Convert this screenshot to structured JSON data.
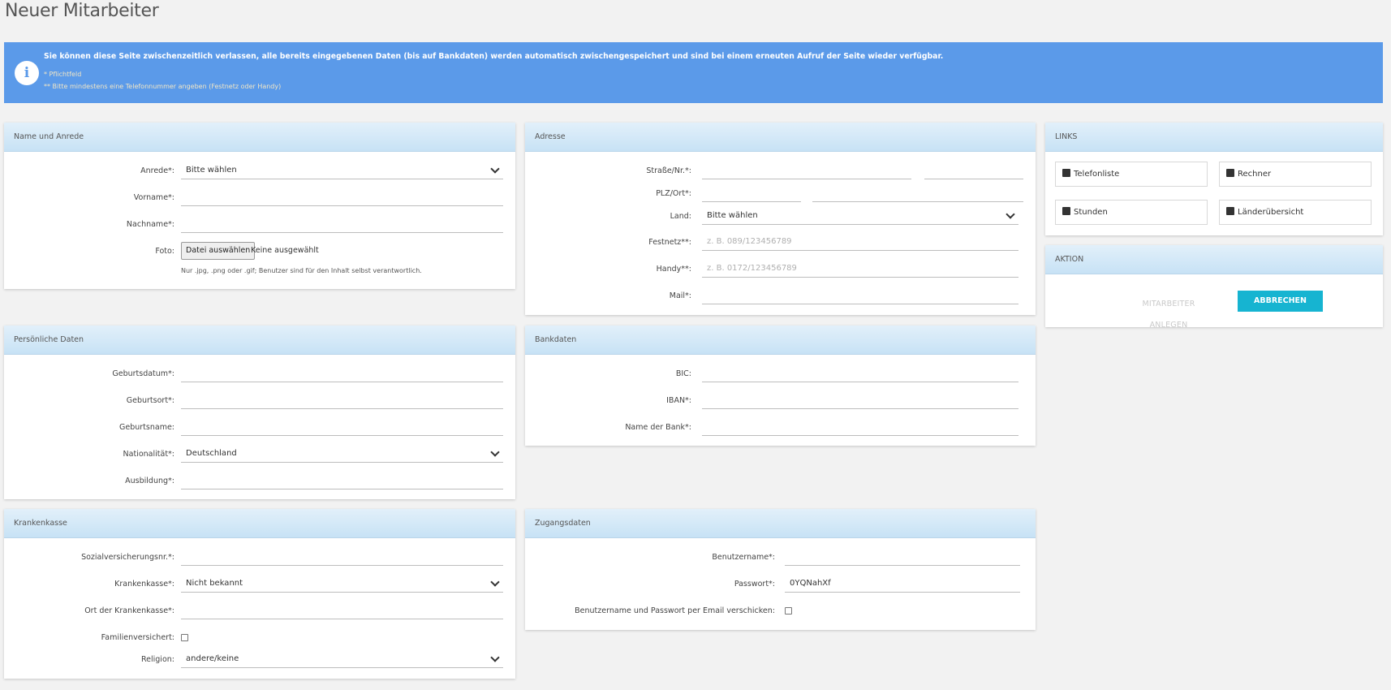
{
  "page": {
    "title": "Neuer Mitarbeiter"
  },
  "info": {
    "message": "Sie können diese Seite zwischenzeitlich verlassen, alle bereits eingegebenen Daten (bis auf Bankdaten) werden automatisch zwischengespeichert und sind bei einem erneuten Aufruf der Seite wieder verfügbar.",
    "note_required": "*  Pflichtfeld",
    "note_phone": "**  Bitte mindestens eine Telefonnummer angeben (Festnetz oder Handy)",
    "icon": "info-icon"
  },
  "name": {
    "title": "Name und Anrede",
    "anrede_label": "Anrede*:",
    "anrede_value": "Bitte wählen",
    "vorname_label": "Vorname*:",
    "nachname_label": "Nachname*:",
    "foto_label": "Foto:",
    "file_button": "Datei auswählen",
    "file_none": "Keine ausgewählt",
    "file_hint": "Nur .jpg, .png oder .gif; Benutzer sind für den Inhalt selbst verantwortlich."
  },
  "personal": {
    "title": "Persönliche Daten",
    "geburtsdatum_label": "Geburtsdatum*:",
    "geburtsort_label": "Geburtsort*:",
    "geburtsname_label": "Geburtsname:",
    "nationalitaet_label": "Nationalität*:",
    "nationalitaet_value": "Deutschland",
    "ausbildung_label": "Ausbildung*:"
  },
  "health": {
    "title": "Krankenkasse",
    "svnr_label": "Sozialversicherungsnr.*:",
    "kasse_label": "Krankenkasse*:",
    "kasse_value": "Nicht bekannt",
    "ort_label": "Ort der Krankenkasse*:",
    "familie_label": "Familienversichert:",
    "religion_label": "Religion:",
    "religion_value": "andere/keine"
  },
  "address": {
    "title": "Adresse",
    "strasse_label": "Straße/Nr.*:",
    "plz_label": "PLZ/Ort*:",
    "land_label": "Land:",
    "land_value": "Bitte wählen",
    "festnetz_label": "Festnetz**:",
    "festnetz_placeholder": "z. B. 089/123456789",
    "handy_label": "Handy**:",
    "handy_placeholder": "z. B. 0172/123456789",
    "mail_label": "Mail*:"
  },
  "bank": {
    "title": "Bankdaten",
    "bic_label": "BIC:",
    "iban_label": "IBAN*:",
    "bankname_label": "Name der Bank*:"
  },
  "access": {
    "title": "Zugangsdaten",
    "username_label": "Benutzername*:",
    "password_label": "Passwort*:",
    "password_value": "0YQNahXf",
    "send_label": "Benutzername und Passwort per Email verschicken:"
  },
  "links": {
    "title": "LINKS",
    "items": [
      {
        "label": "Telefonliste",
        "icon": "phone-book-icon"
      },
      {
        "label": "Rechner",
        "icon": "calculator-icon"
      },
      {
        "label": "Stunden",
        "icon": "user-clock-icon"
      },
      {
        "label": "Länderübersicht",
        "icon": "book-icon"
      }
    ]
  },
  "action": {
    "title": "AKTION",
    "create_label": "MITARBEITER ANLEGEN",
    "cancel_label": "ABBRECHEN",
    "colors": {
      "primary": "#16b4d1",
      "info": "#5b9ae9"
    }
  }
}
